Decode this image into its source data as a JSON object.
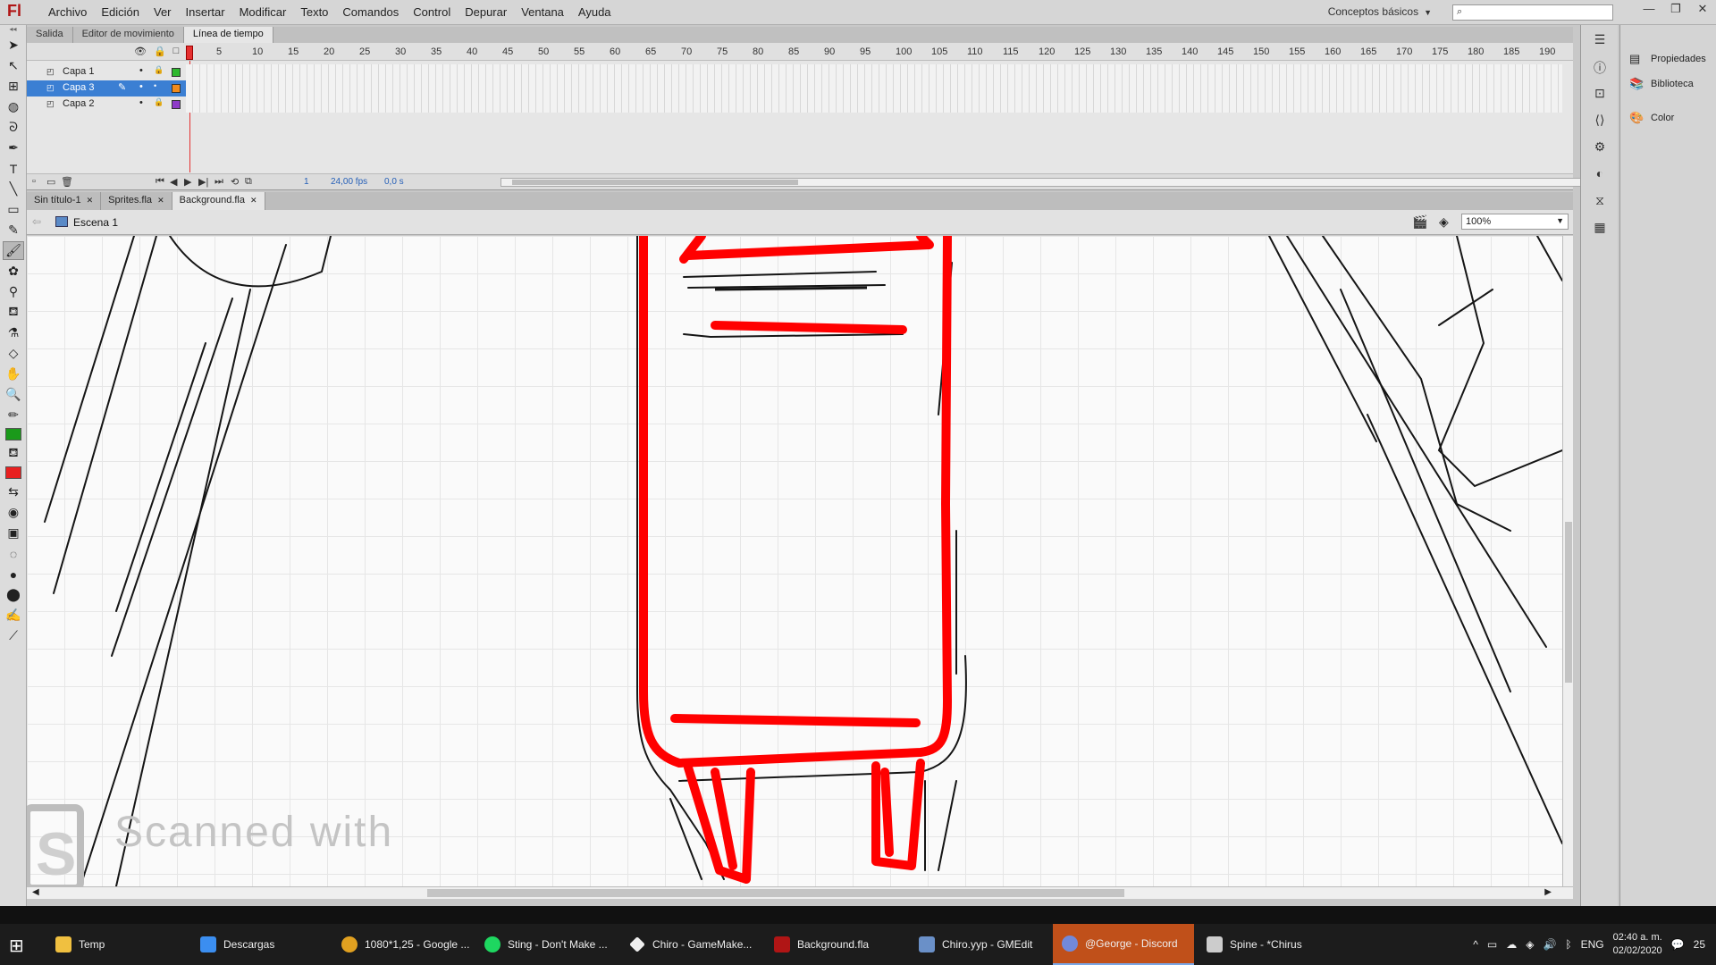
{
  "app": {
    "logo": "Fl",
    "menu": [
      "Archivo",
      "Edición",
      "Ver",
      "Insertar",
      "Modificar",
      "Texto",
      "Comandos",
      "Control",
      "Depurar",
      "Ventana",
      "Ayuda"
    ],
    "workspace": "Conceptos básicos",
    "search_placeholder": ""
  },
  "panel_tabs": [
    "Salida",
    "Editor de movimiento",
    "Línea de tiempo"
  ],
  "timeline": {
    "ruler": [
      "1",
      "5",
      "10",
      "15",
      "20",
      "25",
      "30",
      "35",
      "40",
      "45",
      "50",
      "55",
      "60",
      "65",
      "70",
      "75",
      "80",
      "85",
      "90",
      "95",
      "100",
      "105",
      "110",
      "115",
      "120",
      "125",
      "130",
      "135",
      "140",
      "145",
      "150",
      "155",
      "160",
      "165",
      "170",
      "175",
      "180",
      "185",
      "190"
    ],
    "layers": [
      {
        "name": "Capa 1",
        "color": "#2eb82e",
        "selected": false
      },
      {
        "name": "Capa 3",
        "color": "#f08a1c",
        "selected": true
      },
      {
        "name": "Capa 2",
        "color": "#8e3ac8",
        "selected": false
      }
    ],
    "current_frame": "1",
    "fps": "24,00 fps",
    "time": "0,0 s"
  },
  "doc_tabs": [
    "Sin título-1",
    "Sprites.fla",
    "Background.fla"
  ],
  "scene": "Escena 1",
  "zoom": "100%",
  "stage": {
    "watermark": "Scanned with"
  },
  "right_panel": [
    "Propiedades",
    "Biblioteca",
    "Color"
  ],
  "colors": {
    "stroke": "#1a9a1a",
    "fill": "#e82020",
    "drawing": "#ff0000"
  },
  "taskbar": {
    "items": [
      "Temp",
      "Descargas",
      "1080*1,25 - Google ...",
      "Sting - Don't Make ...",
      "Chiro - GameMake...",
      "Background.fla",
      "Chiro.yyp - GMEdit",
      "@George - Discord",
      "Spine - *Chirus"
    ],
    "language": "ENG",
    "time": "02:40 a. m.",
    "date": "02/02/2020",
    "notifications": "25"
  }
}
